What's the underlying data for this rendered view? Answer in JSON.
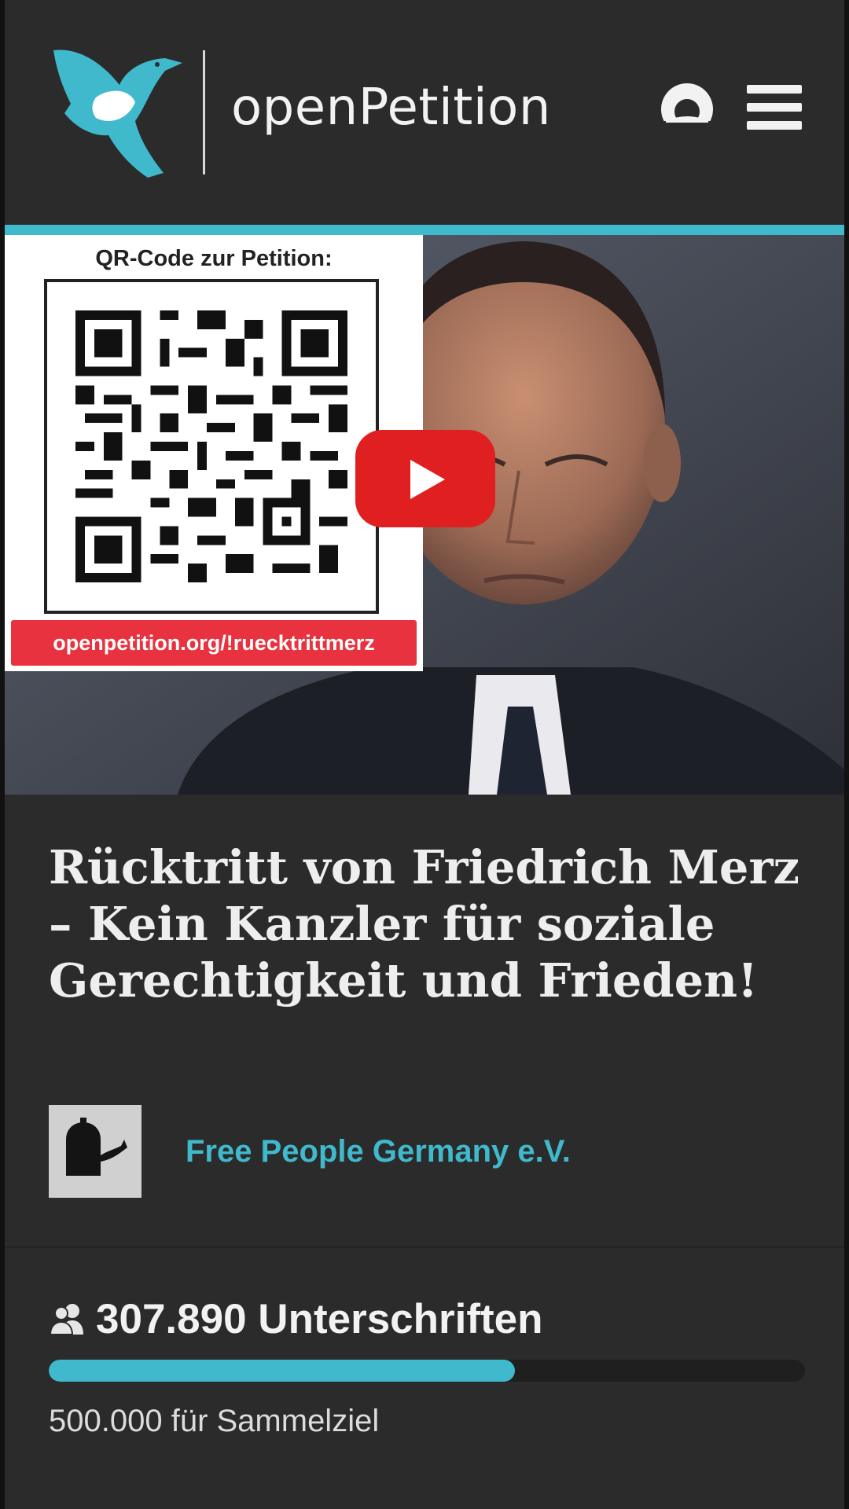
{
  "header": {
    "brand": "openPetition",
    "user_icon": "user-account-icon",
    "menu_icon": "hamburger-menu-icon"
  },
  "hero": {
    "qr_caption": "QR-Code zur Petition:",
    "qr_link": "openpetition.org/!ruecktrittmerz",
    "play_icon": "youtube-play-icon"
  },
  "petition": {
    "title": "Rücktritt von Friedrich Merz – Kein Kanzler für soziale Gerechtigkeit und Frieden!",
    "author": "Free People Germany e.V.",
    "signatures": "307.890 Unterschriften",
    "goal": "500.000 für Sammelziel",
    "progress": 0.616
  },
  "colors": {
    "accent": "#3fb9cb",
    "background": "#2b2b2c",
    "qr_link_bg": "#e8323f",
    "youtube_red": "#e01f20"
  }
}
